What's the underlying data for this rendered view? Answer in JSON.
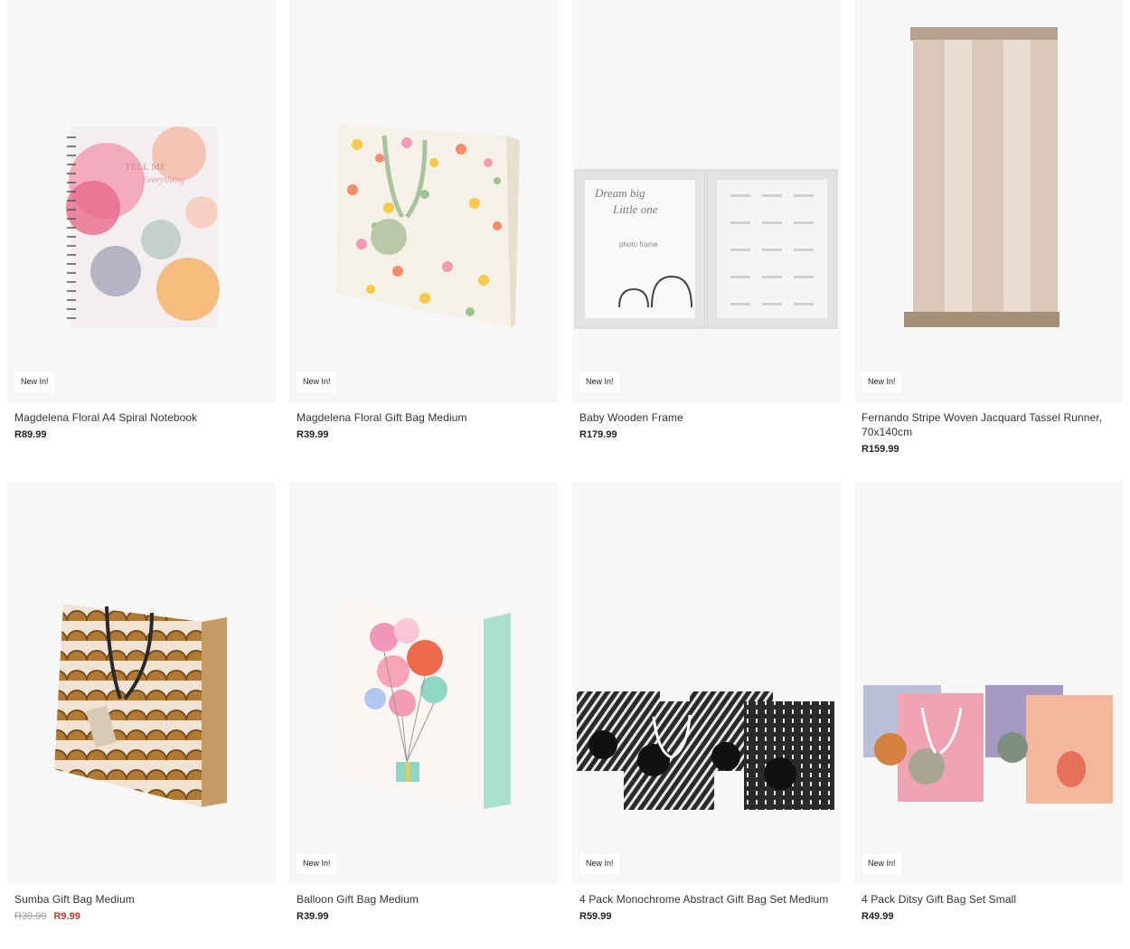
{
  "products": [
    {
      "name": "Magdelena Floral A4 Spiral Notebook",
      "price": "R89.99",
      "badge": "New In!",
      "image_text_1": "TELL ME",
      "image_text_2": "Everything"
    },
    {
      "name": "Magdelena Floral Gift Bag Medium",
      "price": "R39.99",
      "badge": "New In!"
    },
    {
      "name": "Baby Wooden Frame",
      "price": "R179.99",
      "badge": "New In!",
      "image_text_1": "Dream big",
      "image_text_2": "Little one",
      "image_text_3": "photo frame"
    },
    {
      "name": "Fernando Stripe Woven Jacquard Tassel Runner, 70x140cm",
      "price": "R159.99",
      "badge": "New In!"
    },
    {
      "name": "Sumba Gift Bag Medium",
      "old_price": "R39.99",
      "price": "R9.99"
    },
    {
      "name": "Balloon Gift Bag Medium",
      "price": "R39.99",
      "badge": "New In!"
    },
    {
      "name": "4 Pack Monochrome Abstract Gift Bag Set Medium",
      "price": "R59.99",
      "badge": "New In!"
    },
    {
      "name": "4 Pack Ditsy Gift Bag Set Small",
      "price": "R49.99",
      "badge": "New In!"
    }
  ],
  "colors": {
    "card_bg": "#f7f7f7",
    "sale": "#c0392b",
    "old_price": "#9a9a9a"
  }
}
